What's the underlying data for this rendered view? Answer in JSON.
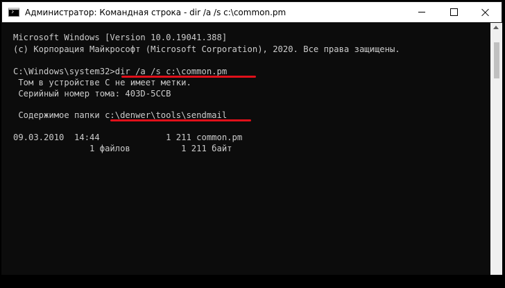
{
  "window": {
    "title": "Администратор: Командная строка - dir  /a /s c:\\common.pm"
  },
  "console": {
    "lines": [
      "Microsoft Windows [Version 10.0.19041.388]",
      "(c) Корпорация Майкрософт (Microsoft Corporation), 2020. Все права защищены.",
      "",
      "C:\\Windows\\system32>dir /a /s c:\\common.pm",
      " Том в устройстве C не имеет метки.",
      " Серийный номер тома: 403D-5CCB",
      "",
      " Содержимое папки c:\\denwer\\tools\\sendmail",
      "",
      "09.03.2010  14:44             1 211 common.pm",
      "               1 файлов          1 211 байт"
    ]
  },
  "colors": {
    "console_background": "#0c0c0c",
    "console_text": "#cccccc",
    "annotation_underline": "#e0101a"
  }
}
